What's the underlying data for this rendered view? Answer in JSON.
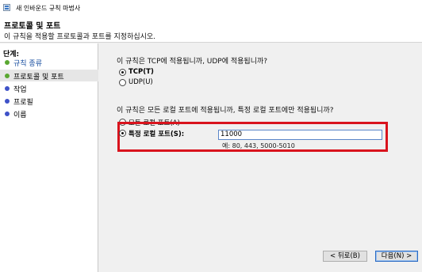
{
  "window": {
    "title": "새 인바운드 규칙 마법사"
  },
  "header": {
    "title": "프로토콜 및 포트",
    "description": "이 규칙을 적용할 프로토콜과 포트를 지정하십시오."
  },
  "sidebar": {
    "title": "단계:",
    "steps": [
      {
        "label": "규칙 종류",
        "state": "done"
      },
      {
        "label": "프로토콜 및 포트",
        "state": "current"
      },
      {
        "label": "작업",
        "state": "pending"
      },
      {
        "label": "프로필",
        "state": "pending"
      },
      {
        "label": "이름",
        "state": "pending"
      }
    ]
  },
  "protocol": {
    "question": "이 규칙은 TCP에 적용됩니까, UDP에 적용됩니까?",
    "options": [
      {
        "label": "TCP(T)",
        "checked": true
      },
      {
        "label": "UDP(U)",
        "checked": false
      }
    ]
  },
  "ports": {
    "question": "이 규칙은 모든 로컬 포트에 적용됩니까, 특정 로컬 포트에만 적용됩니까?",
    "all_label": "모든 로컬 포트(A)",
    "specific_label": "특정 로컬 포트(S):",
    "selected": "specific",
    "input_value": "11000",
    "example": "예: 80, 443, 5000-5010"
  },
  "buttons": {
    "back": "< 뒤로(B)",
    "next": "다음(N) >"
  },
  "colors": {
    "highlight_border": "#d9131d",
    "step_done": "#5aa832",
    "step_pending": "#3f52c8"
  }
}
